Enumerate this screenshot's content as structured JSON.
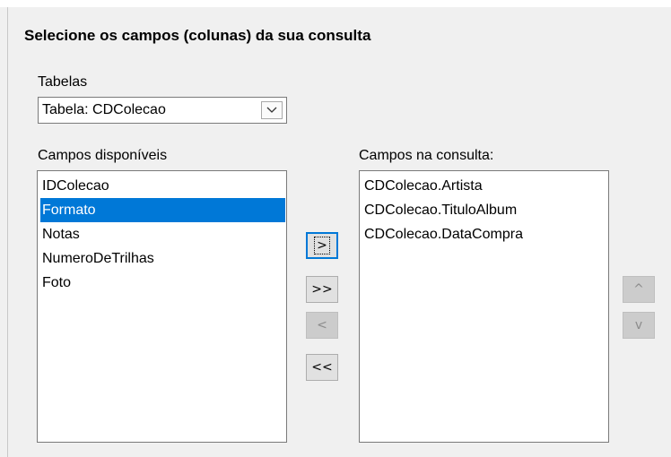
{
  "heading": "Selecione os campos (colunas) da sua consulta",
  "tables": {
    "label": "Tabelas",
    "selected": "Tabela: CDColecao"
  },
  "available": {
    "label": "Campos disponíveis",
    "items": [
      "IDColecao",
      "Formato",
      "Notas",
      "NumeroDeTrilhas",
      "Foto"
    ],
    "selected_index": 1
  },
  "query": {
    "label": "Campos na consulta:",
    "items": [
      "CDColecao.Artista",
      "CDColecao.TituloAlbum",
      "CDColecao.DataCompra"
    ]
  },
  "buttons": {
    "add": ">",
    "add_all": ">>",
    "remove": "<",
    "remove_all": "<<",
    "move_up": "^",
    "move_down": "v"
  },
  "colors": {
    "selection": "#0078d7",
    "panel": "#f0f0f0"
  }
}
